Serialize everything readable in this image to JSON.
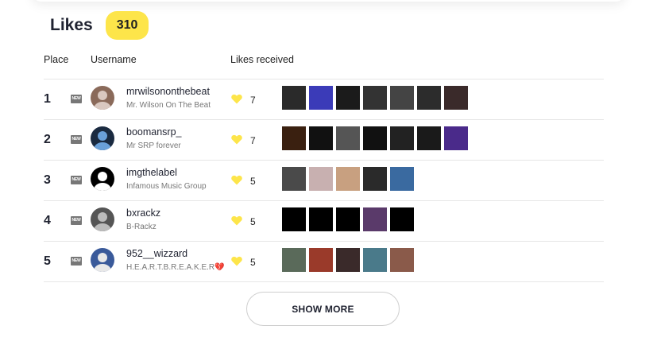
{
  "header": {
    "title": "Likes",
    "count": "310"
  },
  "columns": {
    "place": "Place",
    "username": "Username",
    "likes_received": "Likes received"
  },
  "accent_color": "#fde54a",
  "heart_color": "#fde54a",
  "rows": [
    {
      "place": "1",
      "badge": "NEW",
      "username": "mrwilsononthebeat",
      "display_name": "Mr. Wilson On The Beat",
      "likes": "7",
      "avatar_colors": [
        "#8a6a5a",
        "#d9c8c0"
      ],
      "thumbs": [
        "#2a2a2a",
        "#3b3bb8",
        "#1b1b1b",
        "#333333",
        "#444444",
        "#2c2c2c",
        "#3a2a2a"
      ]
    },
    {
      "place": "2",
      "badge": "NEW",
      "username": "boomansrp_",
      "display_name": "Mr SRP forever",
      "likes": "7",
      "avatar_colors": [
        "#1a2a40",
        "#6aa0d8"
      ],
      "thumbs": [
        "#3a2010",
        "#111111",
        "#555555",
        "#111111",
        "#222222",
        "#1a1a1a",
        "#4a2a8a"
      ]
    },
    {
      "place": "3",
      "badge": "NEW",
      "username": "imgthelabel",
      "display_name": "Infamous Music Group",
      "likes": "5",
      "avatar_colors": [
        "#000000",
        "#ffffff"
      ],
      "thumbs": [
        "#4a4a4a",
        "#c8b0b0",
        "#c8a080",
        "#2a2a2a",
        "#3a6aa0"
      ]
    },
    {
      "place": "4",
      "badge": "NEW",
      "username": "bxrackz",
      "display_name": "B-Rackz",
      "likes": "5",
      "avatar_colors": [
        "#555555",
        "#bbbbbb"
      ],
      "thumbs": [
        "#000000",
        "#000000",
        "#000000",
        "#5a3a6a",
        "#000000"
      ]
    },
    {
      "place": "5",
      "badge": "NEW",
      "username": "952__wizzard",
      "display_name": "H.E.A.R.T.B.R.E.A.K.E.R",
      "display_suffix": "💔",
      "likes": "5",
      "avatar_colors": [
        "#3a5a9a",
        "#e8e8e8"
      ],
      "thumbs": [
        "#5a6a5a",
        "#9a3a2a",
        "#3a2a2a",
        "#4a7a8a",
        "#8a5a4a"
      ]
    }
  ],
  "show_more_label": "SHOW MORE"
}
